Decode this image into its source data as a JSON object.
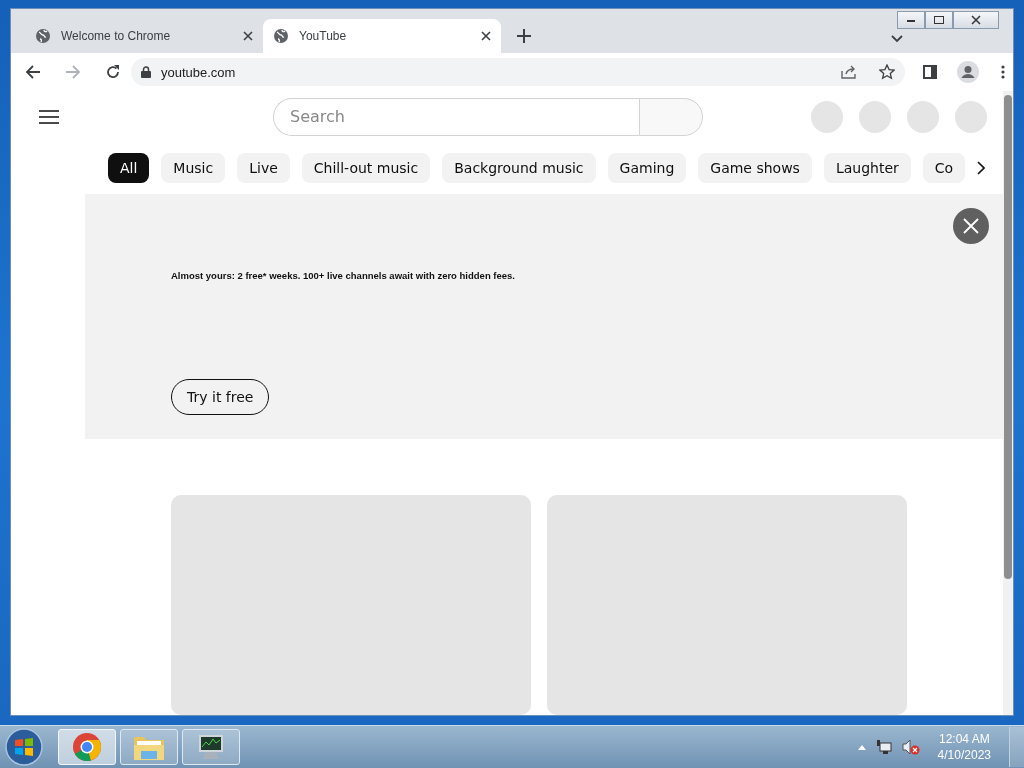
{
  "browser": {
    "tabs": [
      {
        "title": "Welcome to Chrome",
        "selected": false
      },
      {
        "title": "YouTube",
        "selected": true
      }
    ],
    "address": "youtube.com"
  },
  "page": {
    "search": {
      "placeholder": "Search"
    },
    "chips": [
      {
        "label": "All",
        "selected": true
      },
      {
        "label": "Music",
        "selected": false
      },
      {
        "label": "Live",
        "selected": false
      },
      {
        "label": "Chill-out music",
        "selected": false
      },
      {
        "label": "Background music",
        "selected": false
      },
      {
        "label": "Gaming",
        "selected": false
      },
      {
        "label": "Game shows",
        "selected": false
      },
      {
        "label": "Laughter",
        "selected": false
      },
      {
        "label": "Co",
        "selected": false
      }
    ],
    "ad": {
      "text": "Almost yours: 2 free* weeks. 100+ live channels await with zero hidden fees.",
      "button": "Try it free"
    }
  },
  "taskbar": {
    "apps": [
      {
        "kind": "chrome",
        "selected": true
      },
      {
        "kind": "folder",
        "selected": false
      },
      {
        "kind": "monitor",
        "selected": false
      }
    ],
    "clock": {
      "time": "12:04 AM",
      "date": "4/10/2023"
    }
  }
}
